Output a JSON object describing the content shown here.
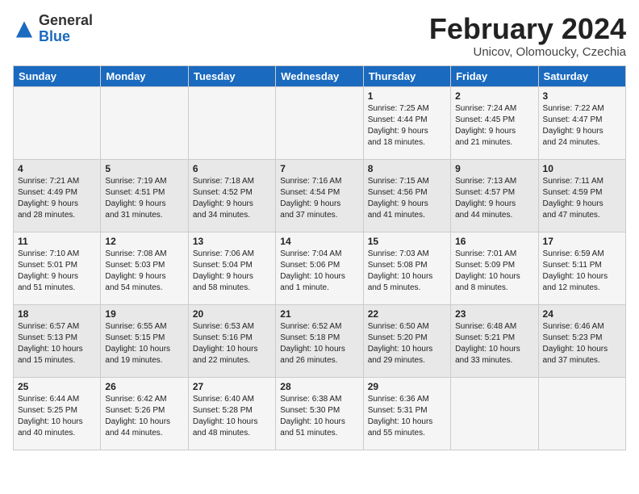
{
  "header": {
    "logo_general": "General",
    "logo_blue": "Blue",
    "month_title": "February 2024",
    "subtitle": "Unicov, Olomoucky, Czechia"
  },
  "days_of_week": [
    "Sunday",
    "Monday",
    "Tuesday",
    "Wednesday",
    "Thursday",
    "Friday",
    "Saturday"
  ],
  "weeks": [
    [
      {
        "day": "",
        "info": ""
      },
      {
        "day": "",
        "info": ""
      },
      {
        "day": "",
        "info": ""
      },
      {
        "day": "",
        "info": ""
      },
      {
        "day": "1",
        "info": "Sunrise: 7:25 AM\nSunset: 4:44 PM\nDaylight: 9 hours\nand 18 minutes."
      },
      {
        "day": "2",
        "info": "Sunrise: 7:24 AM\nSunset: 4:45 PM\nDaylight: 9 hours\nand 21 minutes."
      },
      {
        "day": "3",
        "info": "Sunrise: 7:22 AM\nSunset: 4:47 PM\nDaylight: 9 hours\nand 24 minutes."
      }
    ],
    [
      {
        "day": "4",
        "info": "Sunrise: 7:21 AM\nSunset: 4:49 PM\nDaylight: 9 hours\nand 28 minutes."
      },
      {
        "day": "5",
        "info": "Sunrise: 7:19 AM\nSunset: 4:51 PM\nDaylight: 9 hours\nand 31 minutes."
      },
      {
        "day": "6",
        "info": "Sunrise: 7:18 AM\nSunset: 4:52 PM\nDaylight: 9 hours\nand 34 minutes."
      },
      {
        "day": "7",
        "info": "Sunrise: 7:16 AM\nSunset: 4:54 PM\nDaylight: 9 hours\nand 37 minutes."
      },
      {
        "day": "8",
        "info": "Sunrise: 7:15 AM\nSunset: 4:56 PM\nDaylight: 9 hours\nand 41 minutes."
      },
      {
        "day": "9",
        "info": "Sunrise: 7:13 AM\nSunset: 4:57 PM\nDaylight: 9 hours\nand 44 minutes."
      },
      {
        "day": "10",
        "info": "Sunrise: 7:11 AM\nSunset: 4:59 PM\nDaylight: 9 hours\nand 47 minutes."
      }
    ],
    [
      {
        "day": "11",
        "info": "Sunrise: 7:10 AM\nSunset: 5:01 PM\nDaylight: 9 hours\nand 51 minutes."
      },
      {
        "day": "12",
        "info": "Sunrise: 7:08 AM\nSunset: 5:03 PM\nDaylight: 9 hours\nand 54 minutes."
      },
      {
        "day": "13",
        "info": "Sunrise: 7:06 AM\nSunset: 5:04 PM\nDaylight: 9 hours\nand 58 minutes."
      },
      {
        "day": "14",
        "info": "Sunrise: 7:04 AM\nSunset: 5:06 PM\nDaylight: 10 hours\nand 1 minute."
      },
      {
        "day": "15",
        "info": "Sunrise: 7:03 AM\nSunset: 5:08 PM\nDaylight: 10 hours\nand 5 minutes."
      },
      {
        "day": "16",
        "info": "Sunrise: 7:01 AM\nSunset: 5:09 PM\nDaylight: 10 hours\nand 8 minutes."
      },
      {
        "day": "17",
        "info": "Sunrise: 6:59 AM\nSunset: 5:11 PM\nDaylight: 10 hours\nand 12 minutes."
      }
    ],
    [
      {
        "day": "18",
        "info": "Sunrise: 6:57 AM\nSunset: 5:13 PM\nDaylight: 10 hours\nand 15 minutes."
      },
      {
        "day": "19",
        "info": "Sunrise: 6:55 AM\nSunset: 5:15 PM\nDaylight: 10 hours\nand 19 minutes."
      },
      {
        "day": "20",
        "info": "Sunrise: 6:53 AM\nSunset: 5:16 PM\nDaylight: 10 hours\nand 22 minutes."
      },
      {
        "day": "21",
        "info": "Sunrise: 6:52 AM\nSunset: 5:18 PM\nDaylight: 10 hours\nand 26 minutes."
      },
      {
        "day": "22",
        "info": "Sunrise: 6:50 AM\nSunset: 5:20 PM\nDaylight: 10 hours\nand 29 minutes."
      },
      {
        "day": "23",
        "info": "Sunrise: 6:48 AM\nSunset: 5:21 PM\nDaylight: 10 hours\nand 33 minutes."
      },
      {
        "day": "24",
        "info": "Sunrise: 6:46 AM\nSunset: 5:23 PM\nDaylight: 10 hours\nand 37 minutes."
      }
    ],
    [
      {
        "day": "25",
        "info": "Sunrise: 6:44 AM\nSunset: 5:25 PM\nDaylight: 10 hours\nand 40 minutes."
      },
      {
        "day": "26",
        "info": "Sunrise: 6:42 AM\nSunset: 5:26 PM\nDaylight: 10 hours\nand 44 minutes."
      },
      {
        "day": "27",
        "info": "Sunrise: 6:40 AM\nSunset: 5:28 PM\nDaylight: 10 hours\nand 48 minutes."
      },
      {
        "day": "28",
        "info": "Sunrise: 6:38 AM\nSunset: 5:30 PM\nDaylight: 10 hours\nand 51 minutes."
      },
      {
        "day": "29",
        "info": "Sunrise: 6:36 AM\nSunset: 5:31 PM\nDaylight: 10 hours\nand 55 minutes."
      },
      {
        "day": "",
        "info": ""
      },
      {
        "day": "",
        "info": ""
      }
    ]
  ]
}
